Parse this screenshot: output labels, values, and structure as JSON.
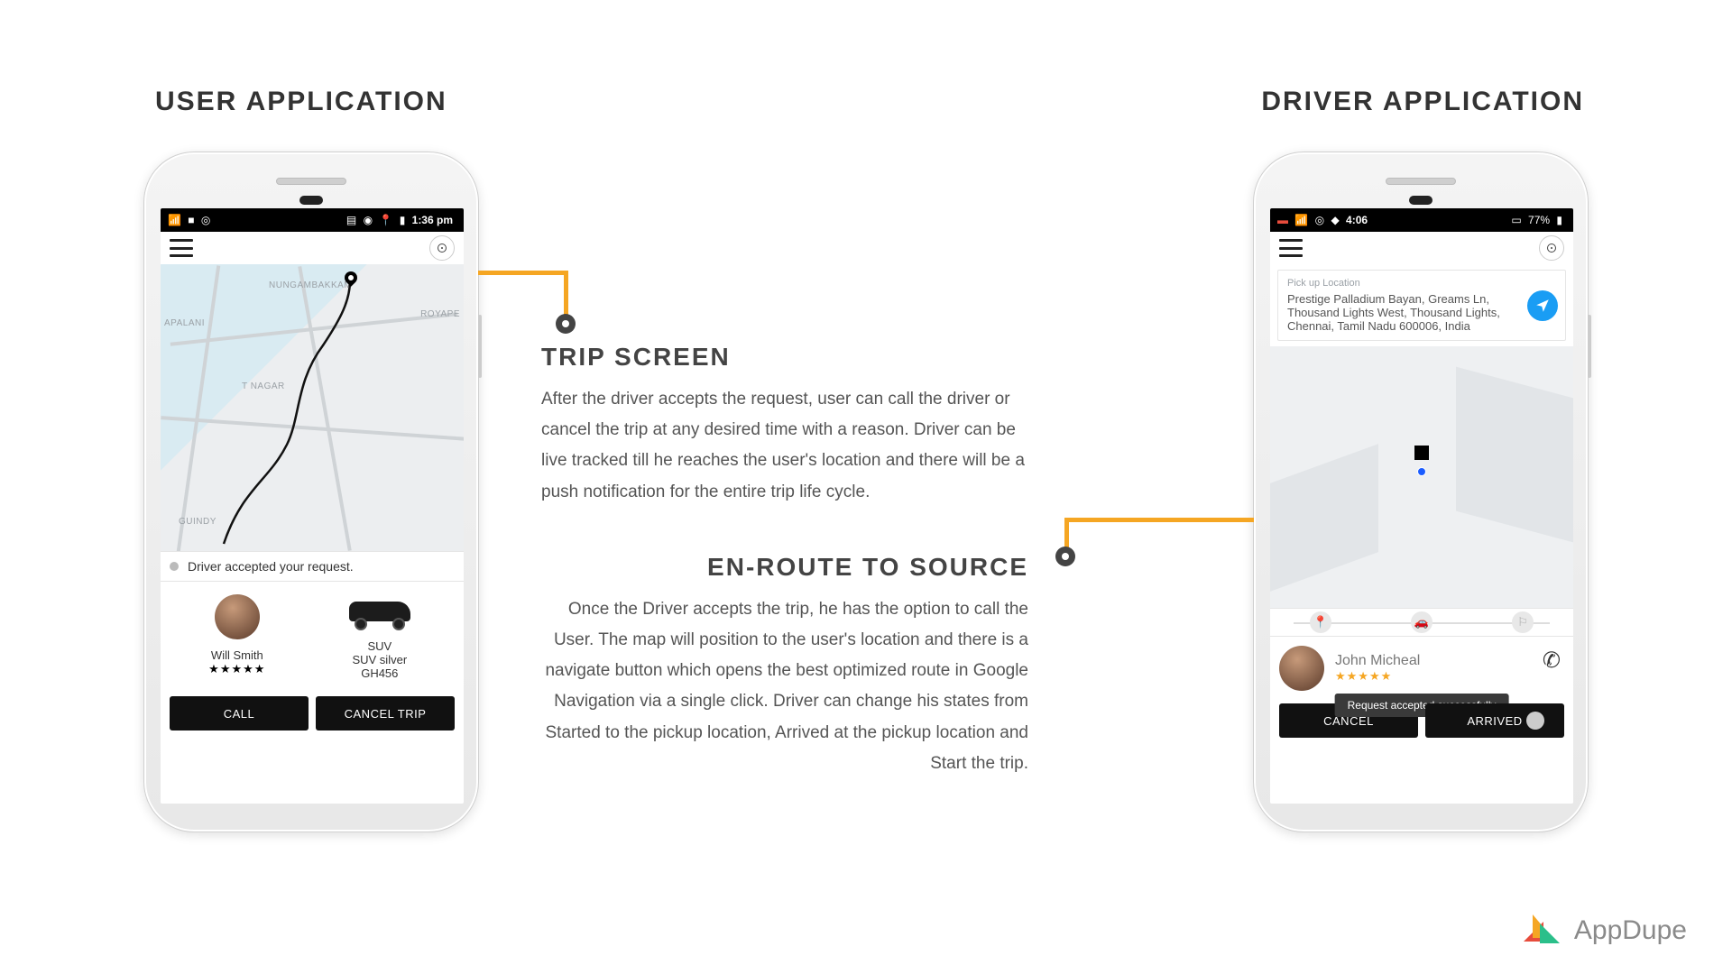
{
  "titles": {
    "left": "USER APPLICATION",
    "right": "DRIVER APPLICATION"
  },
  "center": {
    "trip": {
      "heading": "TRIP SCREEN",
      "body": "After the driver accepts the request, user can call the driver or cancel the trip at any desired time with a reason. Driver can be live tracked till he reaches the user's location and there will be a push notification for the entire trip life cycle."
    },
    "route": {
      "heading": "EN-ROUTE TO SOURCE",
      "body": "Once the Driver accepts the trip, he has the option to call the User. The map will position to the user's location and there is a navigate button which opens the best optimized route in Google Navigation via a single click. Driver can change his states from Started to the pickup location, Arrived at the pickup location and Start the trip."
    }
  },
  "user_app": {
    "status_time": "1:36 pm",
    "map_labels": {
      "l1": "NUNGAMBAKKAM",
      "l2": "APALANI",
      "l3": "T NAGAR",
      "l4": "GUINDY",
      "l5": "ROYAPE"
    },
    "notice": "Driver accepted your request.",
    "driver": {
      "name": "Will Smith",
      "rating_stars": "★★★★★"
    },
    "vehicle": {
      "type": "SUV",
      "desc": "SUV silver",
      "plate": "GH456"
    },
    "buttons": {
      "call": "CALL",
      "cancel": "CANCEL TRIP"
    }
  },
  "driver_app": {
    "status_time": "4:06",
    "battery": "77%",
    "pickup": {
      "label": "Pick up Location",
      "address": "Prestige Palladium Bayan, Greams Ln, Thousand Lights West, Thousand Lights, Chennai, Tamil Nadu 600006, India"
    },
    "rider": {
      "name": "John Micheal",
      "rating_stars": "★★★★★"
    },
    "toast": "Request accepted successfully",
    "buttons": {
      "cancel": "CANCEL",
      "arrived": "ARRIVED"
    }
  },
  "brand": {
    "name": "AppDupe"
  }
}
